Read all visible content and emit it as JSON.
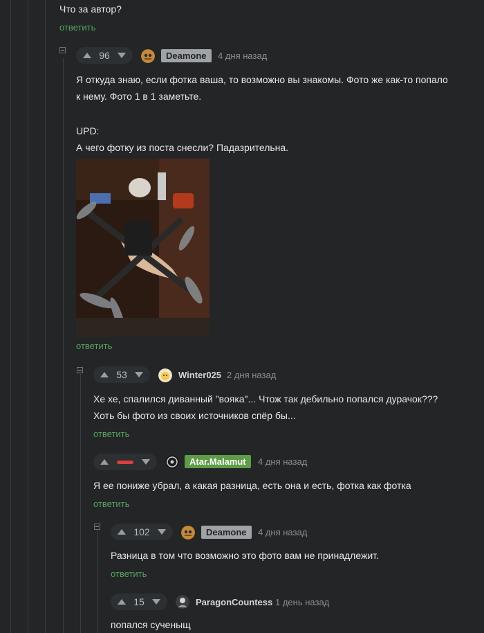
{
  "top": {
    "text": "Что за автор?",
    "reply": "ответить"
  },
  "c1": {
    "votes": "96",
    "user": "Deamone",
    "time": "4 дня назад",
    "lines": [
      "Я откуда знаю, если фотка ваша, то возможно вы знакомы. Фото же как-то попало",
      "к нему. Фото 1 в 1 заметьте.",
      "UPD:",
      "А чего фотку из поста снесли? Падазрительна."
    ],
    "reply": "ответить"
  },
  "c2": {
    "votes": "53",
    "user": "Winter025",
    "time": "2 дня назад",
    "lines": [
      "Хе хе, спалился диванный \"вояка\"... Чтож так дебильно попался дурачок???",
      "Хоть бы фото из своих источников спёр бы..."
    ],
    "reply": "ответить"
  },
  "c3": {
    "user": "Atar.Malamut",
    "time": "4 дня назад",
    "lines": [
      "Я ее пониже убрал, а какая разница, есть она и есть, фотка как фотка"
    ],
    "reply": "ответить"
  },
  "c4": {
    "votes": "102",
    "user": "Deamone",
    "time": "4 дня назад",
    "lines": [
      "Разница в том что возможно это фото вам не принадлежит."
    ],
    "reply": "ответить"
  },
  "c5": {
    "votes": "15",
    "user": "ParagonCountess",
    "time": "1 день назад",
    "lines": [
      "попался сученыщ"
    ]
  },
  "colors": {
    "bg": "#232527",
    "reply_green": "#57a35c",
    "badge_grey": "#9fa2a6",
    "badge_green": "#5f9c47",
    "downvote_red": "#d9403b"
  },
  "icons": [
    "collapse-icon",
    "upvote-icon",
    "downvote-icon",
    "avatar"
  ]
}
